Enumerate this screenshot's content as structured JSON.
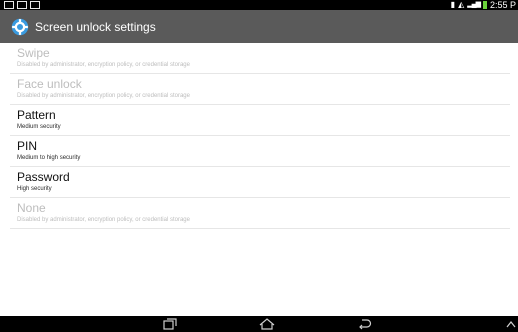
{
  "status_bar": {
    "time": "2:55 P",
    "left_icons": [
      "gallery-icon",
      "mail-icon",
      "photo-icon"
    ],
    "right_icons": [
      "vibrate-icon",
      "wifi-icon",
      "signal-icon",
      "battery-icon"
    ]
  },
  "action_bar": {
    "title": "Screen unlock settings",
    "icon": "settings-gear-icon"
  },
  "options": [
    {
      "title": "Swipe",
      "subtitle": "Disabled by administrator, encryption policy, or credential storage",
      "enabled": false
    },
    {
      "title": "Face unlock",
      "subtitle": "Disabled by administrator, encryption policy, or credential storage",
      "enabled": false
    },
    {
      "title": "Pattern",
      "subtitle": "Medium security",
      "enabled": true
    },
    {
      "title": "PIN",
      "subtitle": "Medium to high security",
      "enabled": true
    },
    {
      "title": "Password",
      "subtitle": "High security",
      "enabled": true
    },
    {
      "title": "None",
      "subtitle": "Disabled by administrator, encryption policy, or credential storage",
      "enabled": false
    }
  ],
  "nav_bar": {
    "buttons": [
      "recent-apps-icon",
      "home-icon",
      "back-icon",
      "menu-up-icon"
    ]
  },
  "colors": {
    "action_bar": "#5a5a5a",
    "status_bar": "#000000",
    "disabled_text": "#bdbdbd",
    "battery": "#6ad23a"
  }
}
